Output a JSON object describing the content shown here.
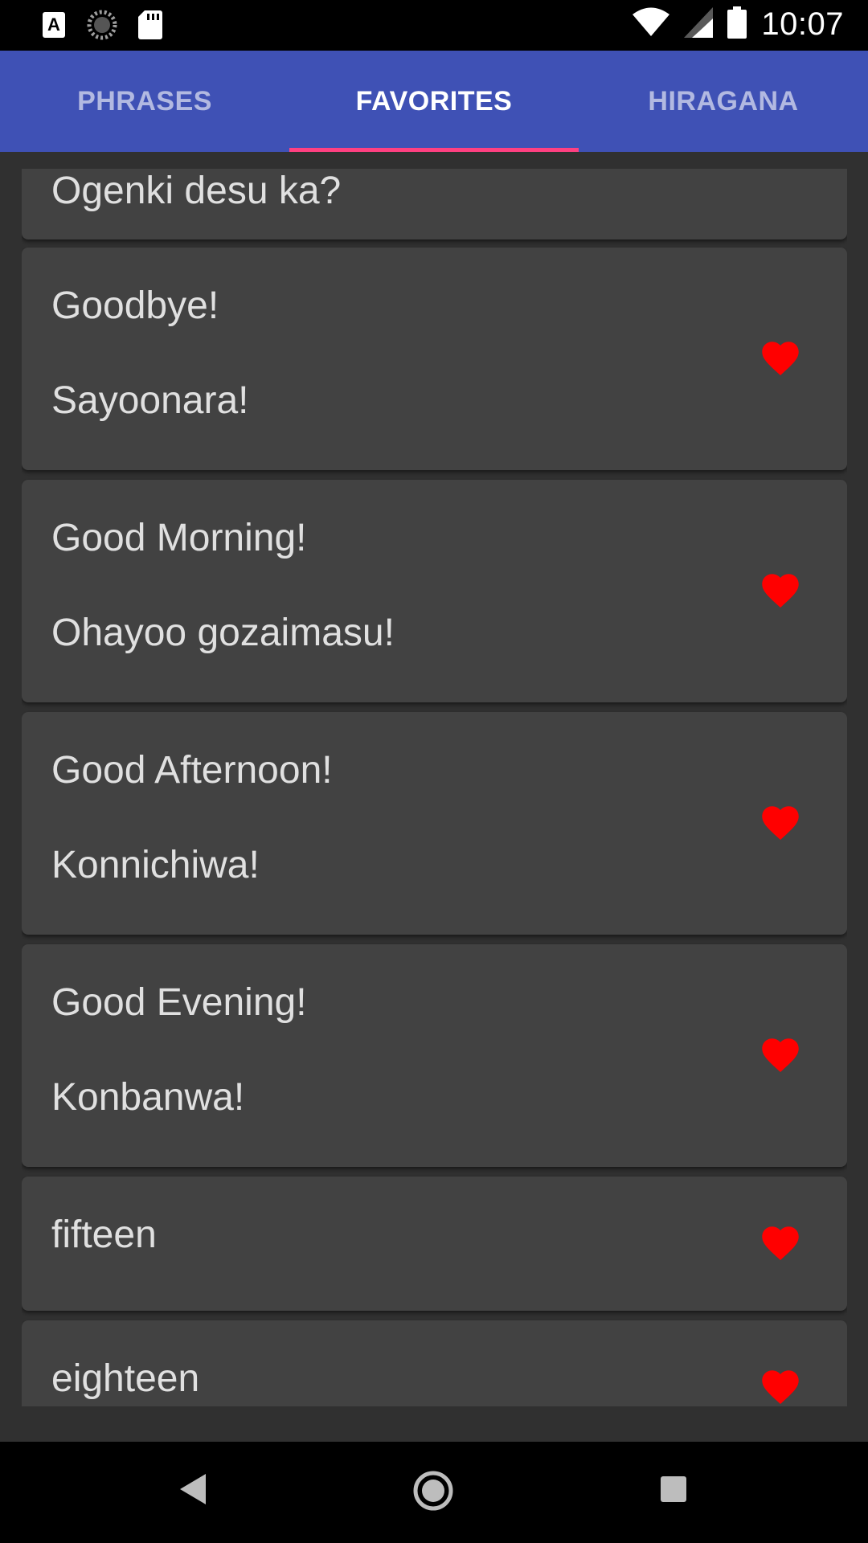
{
  "status_bar": {
    "time": "10:07",
    "left_icons": [
      "font-a-icon",
      "loading-circle-icon",
      "sd-card-icon"
    ],
    "right_icons": [
      "wifi-icon",
      "signal-icon",
      "battery-icon"
    ]
  },
  "tabs": [
    {
      "label": "PHRASES",
      "active": false
    },
    {
      "label": "FAVORITES",
      "active": true
    },
    {
      "label": "HIRAGANA",
      "active": false
    }
  ],
  "colors": {
    "app_bar": "#3F51B5",
    "tab_indicator": "#FF4081",
    "card": "#424242",
    "background": "#303030",
    "heart": "#FF0000"
  },
  "favorites": [
    {
      "english": "",
      "japanese": "Ogenki desu ka?",
      "favorited": true
    },
    {
      "english": "Goodbye!",
      "japanese": "Sayoonara!",
      "favorited": true
    },
    {
      "english": "Good Morning!",
      "japanese": "Ohayoo gozaimasu!",
      "favorited": true
    },
    {
      "english": "Good Afternoon!",
      "japanese": "Konnichiwa!",
      "favorited": true
    },
    {
      "english": "Good Evening!",
      "japanese": "Konbanwa!",
      "favorited": true
    },
    {
      "english": "fifteen",
      "japanese": "",
      "favorited": true
    },
    {
      "english": "eighteen",
      "japanese": "",
      "favorited": true
    }
  ],
  "nav_bar": {
    "buttons": [
      "back-icon",
      "home-icon",
      "recents-icon"
    ]
  }
}
